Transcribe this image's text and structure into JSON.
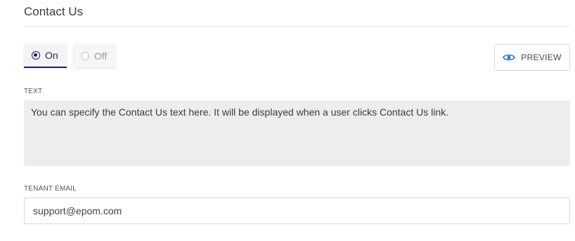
{
  "section": {
    "title": "Contact Us"
  },
  "toggle": {
    "on_label": "On",
    "off_label": "Off",
    "selected": "On"
  },
  "preview_button": {
    "label": "PREVIEW",
    "icon": "eye-icon"
  },
  "text_field": {
    "label": "TEXT",
    "value": "You can specify the Contact Us text here. It will be displayed when a user clicks Contact Us link."
  },
  "email_field": {
    "label": "TENANT EMAIL",
    "value": "support@epom.com"
  },
  "colors": {
    "accent": "#16165a",
    "preview_icon": "#2f6ec0",
    "textarea_bg": "#ededed"
  }
}
